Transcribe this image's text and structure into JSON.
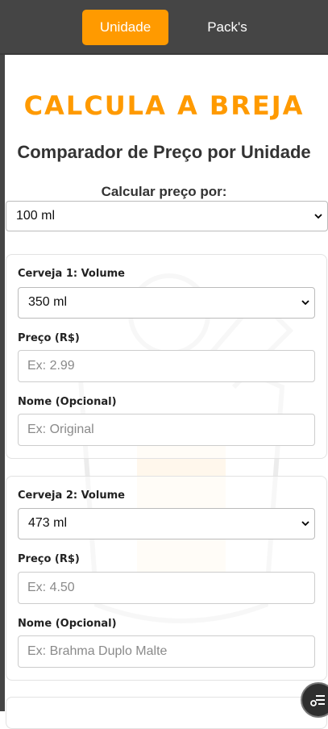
{
  "tabs": [
    {
      "label": "Unidade",
      "active": true
    },
    {
      "label": "Pack's",
      "active": false
    }
  ],
  "brand_title": "CALCULA A BREJA",
  "subtitle": "Comparador de Preço por Unidade",
  "calc_per": {
    "label": "Calcular preço por:",
    "selected": "100 ml"
  },
  "beers": [
    {
      "volume_label": "Cerveja 1: Volume",
      "volume_selected": "350 ml",
      "price_label": "Preço (R$)",
      "price_placeholder": "Ex: 2.99",
      "name_label": "Nome (Opcional)",
      "name_placeholder": "Ex: Original"
    },
    {
      "volume_label": "Cerveja 2: Volume",
      "volume_selected": "473 ml",
      "price_label": "Preço (R$)",
      "price_placeholder": "Ex: 4.50",
      "name_label": "Nome (Opcional)",
      "name_placeholder": "Ex: Brahma Duplo Malte"
    }
  ],
  "colors": {
    "accent": "#ff9a00",
    "topbar": "#454545"
  },
  "icons": {
    "fab": "list-settings-icon",
    "select_arrow": "chevron-down-icon"
  }
}
